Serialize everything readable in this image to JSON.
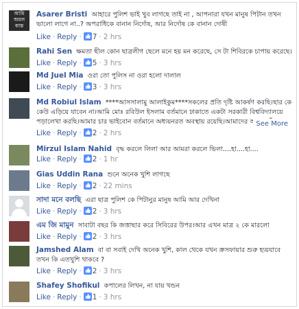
{
  "comments": [
    {
      "name": "Asarer Bristi",
      "text": "আহারে পুলিশ ভাই খুব লাগছে তাই না , আপনারা যখন মানুষ পিটান তখন ভালো লাগে না..? অপরাধিকে বানান নির্দোষ, আর নির্দোষ কে বানান দোষী",
      "avatar_text": "আমি অমল কান্ত",
      "avatar_color": "#2b2b2b",
      "like": "Like",
      "reply": "Reply",
      "likes": "7",
      "time": "2 hrs"
    },
    {
      "name": "Rahi Sen",
      "text": "ক্ষমতা ছীল কোন ছাত্রলীগ ছেলে মনে হয় মন করেছে, সে টা শিবিরকে চাপায় করেছে।",
      "avatar_color": "#5a6f3c",
      "like": "Like",
      "reply": "Reply",
      "likes": "5",
      "time": "3 hrs"
    },
    {
      "name": "Md Juel Mia",
      "text": "ওরা তো পুলিস না ওরা হলো দালাল",
      "avatar_color": "#1a1a1a",
      "like": "Like",
      "reply": "Reply",
      "likes": "3",
      "time": "3 hrs"
    },
    {
      "name": "Md Robiul Islam",
      "text": "****আসসালামু আলাইকুম****সকলের প্রতি দৃষ্টি আকর্ষণ করছি।ছার কে কেউ এড়িয়ে যাবেন না।আমি মোঃ রবিউল ইসলাম বর্তমানে ঢাকাতে একটা সরকারী বিশ্ববিদ্যালয়ে পড়ালেখা করছি।আমার চার ভাইবোন বর্তমানে অধ্যয়নরত অবস্থায় রয়েছি।আমাদের আব্বু বেঁচে নেই।আব্বু মারা...",
      "see_more": "See More",
      "avatar_color": "#3f4a55",
      "like": "Like",
      "reply": "Reply",
      "likes": "2",
      "time": "2 hrs"
    },
    {
      "name": "Mirzul Islam Nahid",
      "text": "বৃদ্ধ করলে লিলা আর আমরা করলে ভিলা....হা....হা....",
      "avatar_color": "#7a8a5e",
      "like": "Like",
      "reply": "Reply",
      "likes": "2",
      "time": "1 hr"
    },
    {
      "name": "Gias Uddin Rana",
      "text": "শুনে অনেক খুশি লাগছে",
      "avatar_color": "#6b7b8c",
      "like": "Like",
      "reply": "Reply",
      "likes": "2",
      "time": "22 mins"
    },
    {
      "name": "সাদা মনে বলছি",
      "text": "এরা ছাত্র পুলিশ কে পিটানুর মানুষ আমি আর দেখিনা",
      "avatar_color": "#d9dce1",
      "like": "Like",
      "reply": "Reply",
      "likes": "2",
      "time": "3 hrs"
    },
    {
      "name": "এম জি মামুন",
      "text": "সাবাটা বছর কি জত্তাছার করে সিবিরের উপর।আর এখন মাত্র ২ কে মারলো",
      "avatar_color": "#7a3b3b",
      "like": "Like",
      "reply": "Reply",
      "likes": "2",
      "time": "3 hrs"
    },
    {
      "name": "Jamshed Alam",
      "text": "বা বা সবাই দেখি অনেক খুশি, কাল থেকে যখন ক্রসফায়ার শুরু হ্যয়যাবে তখন কি এতখুশি থাকবে ?",
      "avatar_color": "#4d5a3a",
      "like": "Like",
      "reply": "Reply",
      "likes": "2",
      "time": "3 hrs"
    },
    {
      "name": "Shafey Shofikul",
      "text": "কপালের লিখন, না যায় খন্ডন",
      "avatar_color": "#8a7a5c",
      "like": "Like",
      "reply": "Reply",
      "likes": "1",
      "time": "3 hrs"
    }
  ],
  "colors": {
    "link": "#365899",
    "meta": "#90949c",
    "thumb": "#5890ff"
  }
}
